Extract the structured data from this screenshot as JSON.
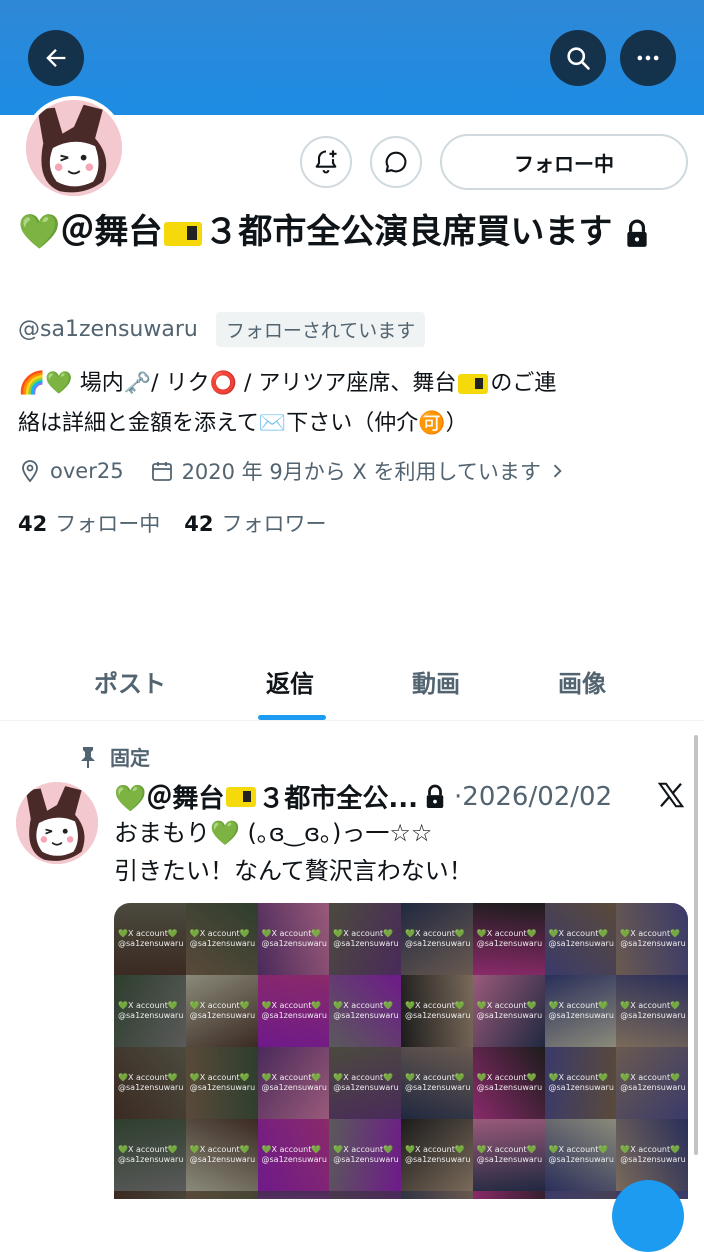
{
  "header": {
    "back_icon": "arrow-left-icon",
    "search_icon": "search-icon",
    "more_icon": "more-horizontal-icon",
    "banner_color": "#1d8ce4"
  },
  "profile": {
    "name_prefix": "💚＠舞台",
    "name_suffix": "３都市全公演良席買います",
    "handle": "@sa1zensuwaru",
    "followed_badge": "フォローされています",
    "follow_button": "フォロー中",
    "bio_line1_a": "🌈💚 場内🗝️/ リク⭕ / アリツア座席、舞台",
    "bio_line1_b": "のご連",
    "bio_line2": "絡は詳細と金額を添えて✉️下さい（仲介🉑）",
    "location": "over25",
    "joined": "2020 年 9月から X を利用しています",
    "following_count": "42",
    "following_label": "フォロー中",
    "followers_count": "42",
    "followers_label": "フォロワー"
  },
  "tabs": [
    {
      "label": "ポスト"
    },
    {
      "label": "返信"
    },
    {
      "label": "動画"
    },
    {
      "label": "画像"
    }
  ],
  "active_tab": "返信",
  "post": {
    "pinned_label": "固定",
    "name_prefix": "💚＠舞台",
    "name_suffix": "３都市全公...",
    "date": "·2026/02/02",
    "line1": "おまもり💚 (｡ɞ‿ɞ｡)っ一☆☆",
    "line2": "引きたい！なんて贅沢言わない！",
    "watermark_line1": "💚X account💚",
    "watermark_line2": "@sa1zensuwaru"
  },
  "accent_color": "#1d9bf0"
}
